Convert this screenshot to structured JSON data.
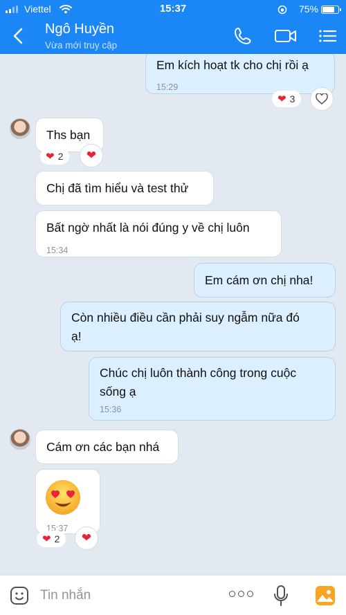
{
  "status_bar": {
    "carrier": "Viettel",
    "time": "15:37",
    "battery": "75%"
  },
  "header": {
    "name": "Ngô Huyền",
    "status": "Vừa mới truy cập"
  },
  "messages": [
    {
      "text": "Em kích hoạt tk cho chị rồi ạ",
      "time": "15:29",
      "reaction_count": "3"
    },
    {
      "text": "Ths bạn",
      "reaction_count": "2"
    },
    {
      "text": "Chị đã tìm hiểu và test thử"
    },
    {
      "text": "Bất ngờ nhất là nói đúng y về chị luôn",
      "time": "15:34"
    },
    {
      "text": "Em cám ơn chị nha!"
    },
    {
      "text_line1": "Còn nhiều điều cần phải suy ngẫm nữa đó",
      "text_line2": "ạ!"
    },
    {
      "text_line1": "Chúc chị luôn thành công trong cuộc",
      "text_line2": "sống ạ",
      "time": "15:36"
    },
    {
      "text": "Cám ơn các bạn nhá"
    },
    {
      "emoji": "😍",
      "time": "15:37",
      "reaction_count": "2"
    }
  ],
  "composer": {
    "placeholder": "Tin nhắn"
  },
  "colors": {
    "brand": "#1b86f5",
    "outgoing_bubble": "#dcefff",
    "heart": "#e5243b"
  },
  "icons": [
    "back-chevron-icon",
    "phone-icon",
    "video-call-icon",
    "menu-icon",
    "sticker-icon",
    "more-icon",
    "microphone-icon",
    "gallery-icon",
    "heart-icon"
  ]
}
